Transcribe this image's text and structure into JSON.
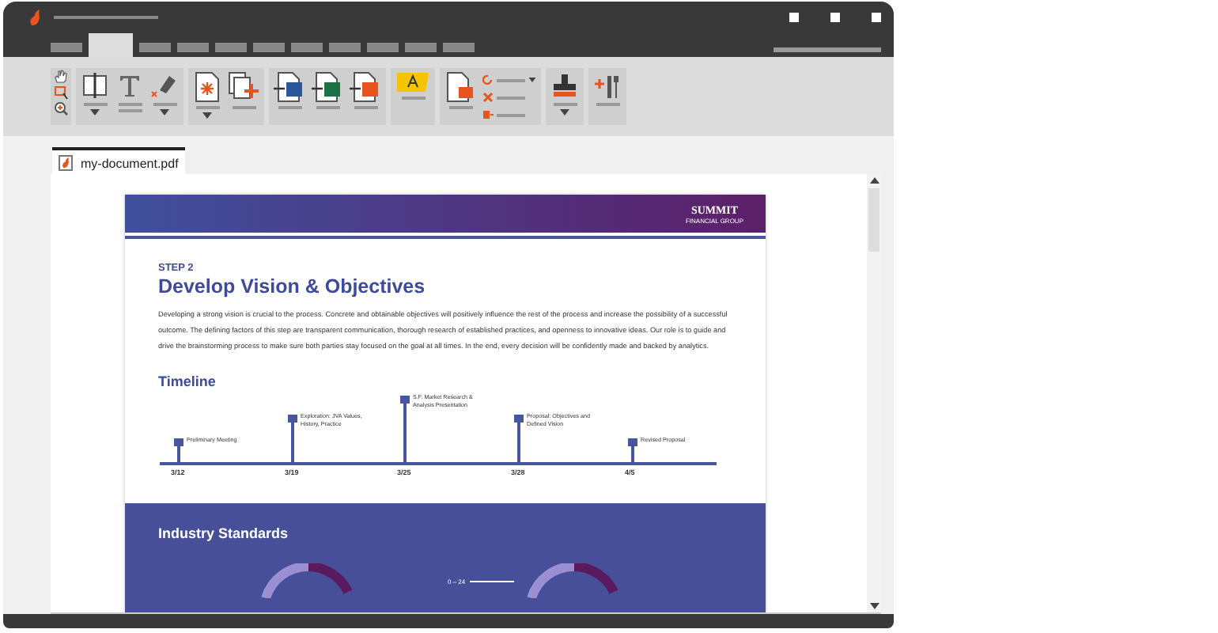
{
  "ribbon_tabs": [
    {
      "selected": false
    },
    {
      "selected": true
    },
    {
      "selected": false
    },
    {
      "selected": false
    },
    {
      "selected": false
    },
    {
      "selected": false
    },
    {
      "selected": false
    },
    {
      "selected": false
    },
    {
      "selected": false
    },
    {
      "selected": false
    },
    {
      "selected": false
    }
  ],
  "document_tab": {
    "label": "my-document.pdf",
    "selected": true
  },
  "page": {
    "brand": "SUMMIT",
    "brand_sub": "FINANCIAL GROUP",
    "step": "STEP 2",
    "title": "Develop Vision & Objectives",
    "paragraph": "Developing a strong vision is crucial to the process. Concrete and obtainable objectives will positively influence the rest of the process and increase the possibility of a successful outcome. The defining factors of this step are transparent communication, thorough research of established practices, and openness to innovative ideas. Our role is to guide and drive the brainstorming process to make sure both parties stay focused on the goal at all times. In the end, every decision will be confidently made and backed by analytics.",
    "timeline": {
      "heading": "Timeline",
      "events": [
        {
          "date": "3/12",
          "label": "Preliminary Meeting"
        },
        {
          "date": "3/19",
          "label": "Exploration: JVA Values, History, Practice"
        },
        {
          "date": "3/25",
          "label": "S.F. Market Research & Analysis Presentation"
        },
        {
          "date": "3/28",
          "label": "Proposal: Objectives and Defined Vision"
        },
        {
          "date": "4/5",
          "label": "Revised Proposal"
        }
      ]
    },
    "section": {
      "heading": "Industry Standards",
      "legend": "0 – 24"
    }
  }
}
